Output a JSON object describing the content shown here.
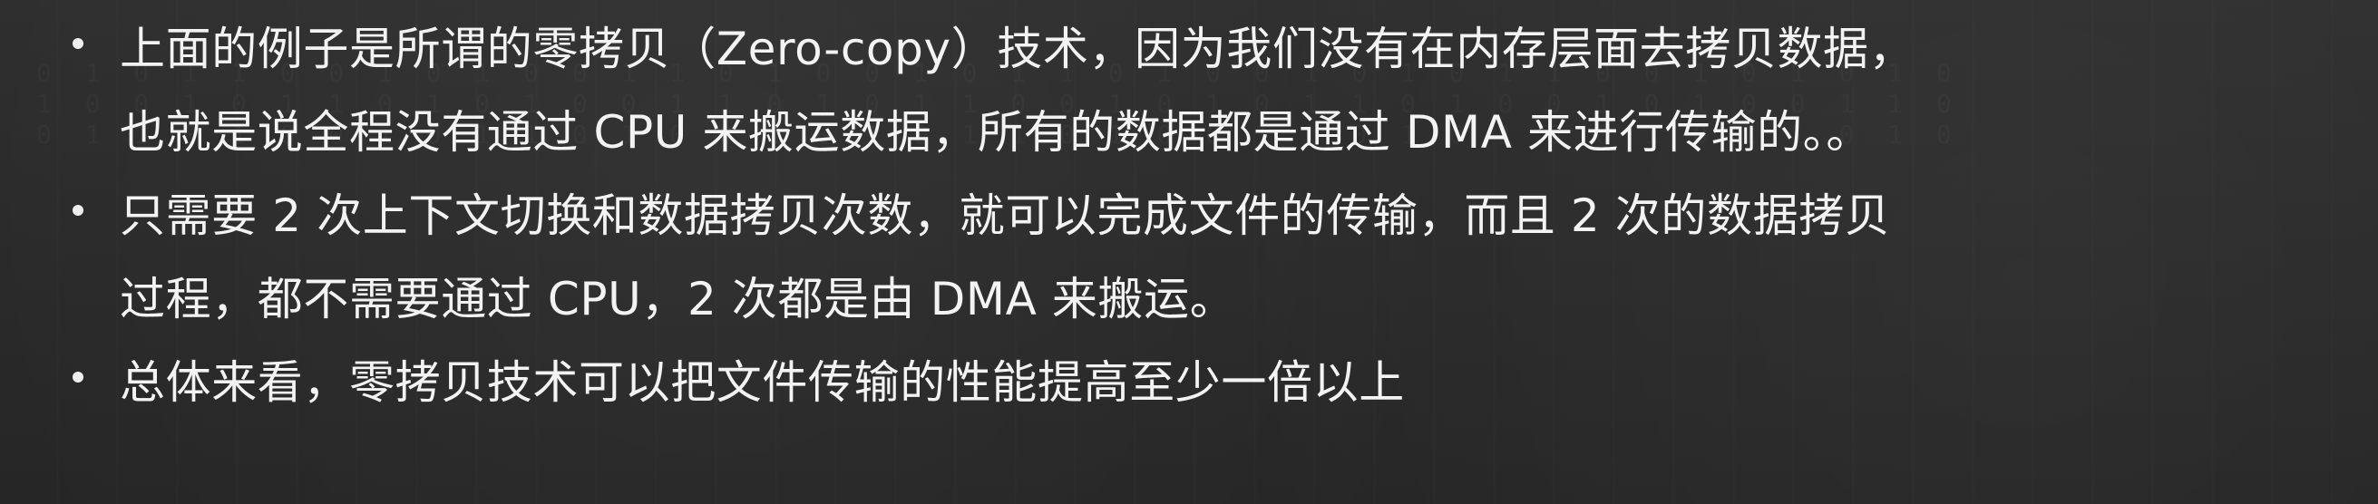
{
  "bullets": [
    {
      "lines": [
        "上面的例子是所谓的零拷贝（Zero-copy）技术，因为我们没有在内存层面去拷贝数据，",
        "也就是说全程没有通过 CPU 来搬运数据，所有的数据都是通过 DMA 来进行传输的。。"
      ]
    },
    {
      "lines": [
        "只需要 2 次上下文切换和数据拷贝次数，就可以完成文件的传输，而且 2 次的数据拷贝",
        "过程，都不需要通过 CPU，2 次都是由 DMA 来搬运。"
      ]
    },
    {
      "lines": [
        "总体来看，零拷贝技术可以把文件传输的性能提高至少一倍以上"
      ]
    }
  ]
}
